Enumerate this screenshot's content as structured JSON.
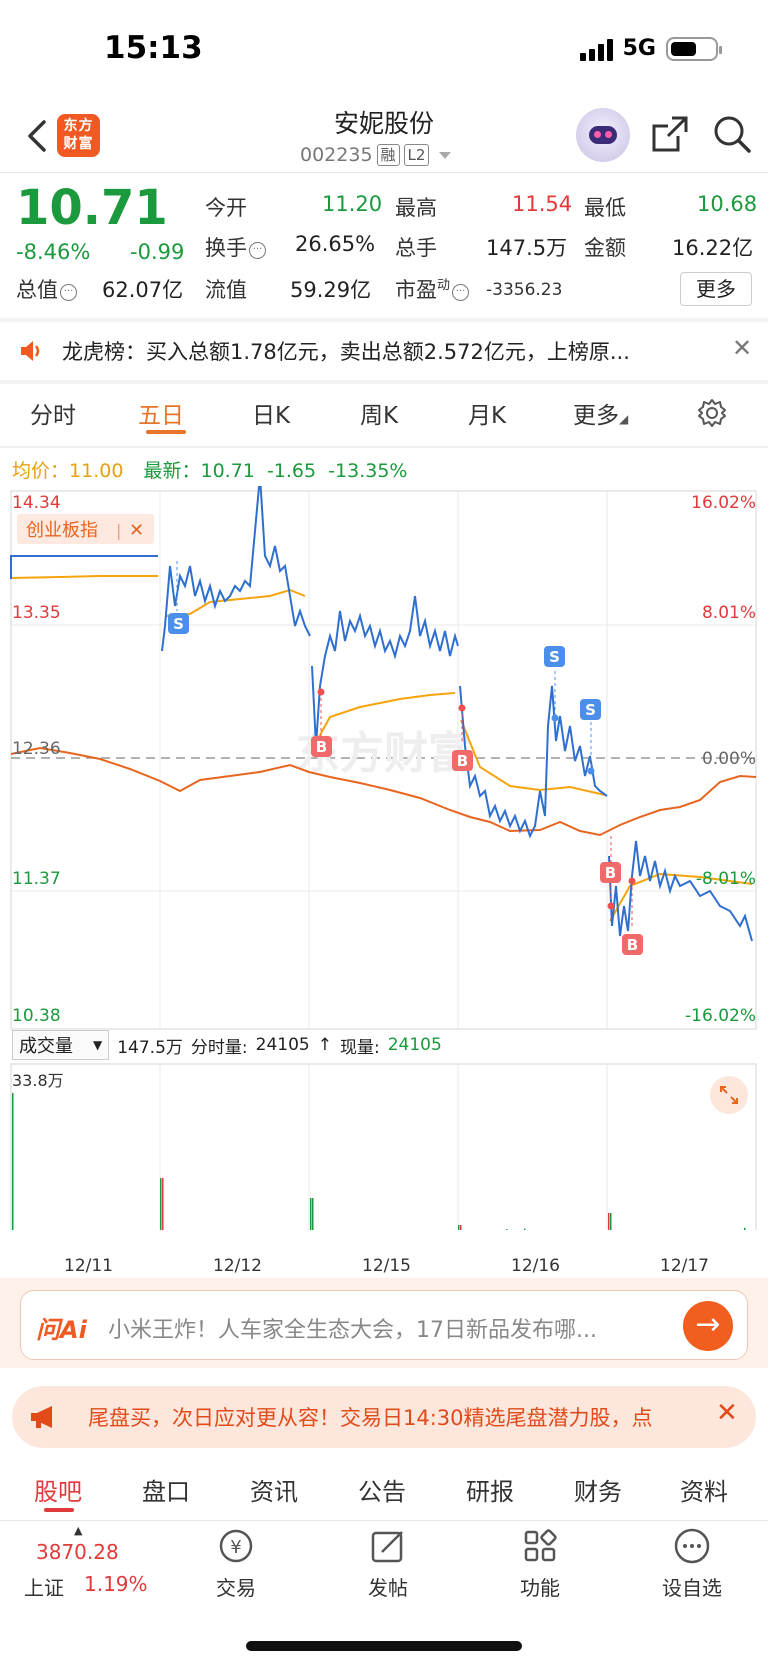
{
  "status_bar": {
    "time": "15:13",
    "network": "5G"
  },
  "header": {
    "logo": "东方财富",
    "title": "安妮股份",
    "code": "002235",
    "tag1": "融",
    "tag2": "L2"
  },
  "quote": {
    "price": "10.71",
    "change_pct": "-8.46%",
    "change": "-0.99",
    "open_label": "今开",
    "open": "11.20",
    "high_label": "最高",
    "high": "11.54",
    "low_label": "最低",
    "low": "10.68",
    "turnover_label": "换手",
    "turnover": "26.65%",
    "volume_label": "总手",
    "volume": "147.5万",
    "amount_label": "金额",
    "amount": "16.22亿",
    "mktcap_label": "总值",
    "mktcap": "62.07亿",
    "float_label": "流值",
    "float": "59.29亿",
    "pe_label": "市盈",
    "pe_sup": "动",
    "pe": "-3356.23",
    "more": "更多"
  },
  "notice": {
    "text": "龙虎榜：买入总额1.78亿元，卖出总额2.572亿元，上榜原..."
  },
  "chart_tabs": [
    "分时",
    "五日",
    "日K",
    "周K",
    "月K",
    "更多"
  ],
  "legend": {
    "avg_label": "均价：",
    "avg": "11.00",
    "latest_label": "最新：",
    "latest": "10.71",
    "chg": "-1.65",
    "chg_pct": "-13.35%"
  },
  "index_tag": "创业板指",
  "y_left": [
    "14.34",
    "13.35",
    "12.36",
    "11.37",
    "10.38"
  ],
  "y_right": [
    "16.02%",
    "8.01%",
    "0.00%",
    "-8.01%",
    "-16.02%"
  ],
  "volume_bar": {
    "selector": "成交量",
    "total": "147.5万",
    "tick_label": "分时量:",
    "tick": "24105",
    "now_label": "现量:",
    "now": "24105",
    "max": "33.8万"
  },
  "dates": [
    "12/11",
    "12/12",
    "12/15",
    "12/16",
    "12/17"
  ],
  "chart_data": {
    "type": "line",
    "x": [
      "12/11",
      "12/12",
      "12/15",
      "12/16",
      "12/17"
    ],
    "ylim": [
      10.38,
      14.34
    ],
    "series": [],
    "markers": [
      "S",
      "B",
      "B",
      "S",
      "S",
      "B",
      "B"
    ]
  },
  "colors": {
    "price_line": "#2f6fcf",
    "avg_line": "#f5a40c",
    "index_line": "#e8651f",
    "up": "#e03a3a",
    "down": "#1a9a3c"
  },
  "ai": {
    "logo": "问Ai",
    "text": "小米王炸！人车家全生态大会，17日新品发布哪..."
  },
  "promo": {
    "text": "尾盘买，次日应对更从容！交易日14:30精选尾盘潜力股，点"
  },
  "bottom_tabs": [
    "股吧",
    "盘口",
    "资讯",
    "公告",
    "研报",
    "财务",
    "资料"
  ],
  "bottom_nav": {
    "index_value": "3870.28",
    "index_name": "上证",
    "index_pct": "1.19%",
    "trade": "交易",
    "post": "发帖",
    "func": "功能",
    "watch": "设自选"
  }
}
